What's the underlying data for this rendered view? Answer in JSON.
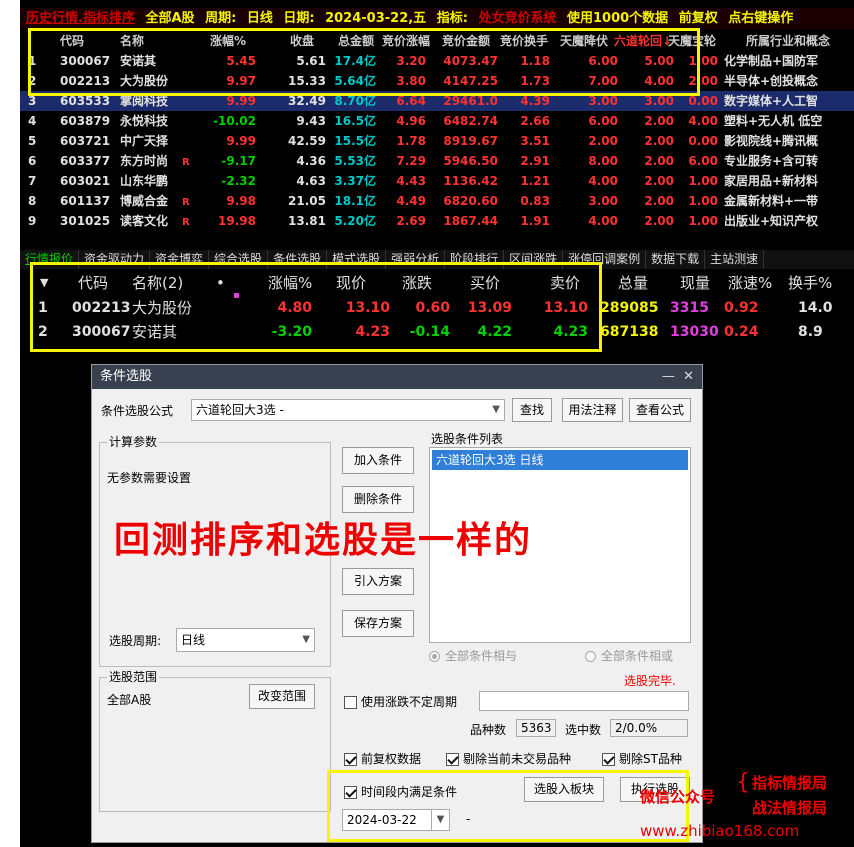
{
  "header": {
    "parts": [
      "历史行情.指标排序",
      "全部A股",
      "周期:",
      "日线",
      "日期:",
      "2024-03-22,五",
      "指标:",
      "处女竞价系统",
      "使用1000个数据",
      "前复权",
      "点右键操作"
    ]
  },
  "top_table": {
    "columns": [
      "代码",
      "名称",
      "涨幅%",
      "收盘",
      "总金额",
      "竞价涨幅",
      "竞价金额",
      "竞价换手",
      "天魔降伏",
      "六道轮回↓",
      "天魔宝轮",
      "所属行业和概念"
    ],
    "rows": [
      [
        "1",
        "300067",
        "安诺其",
        "5.45",
        "5.61",
        "17.4亿",
        "3.20",
        "4073.47",
        "1.18",
        "6.00",
        "5.00",
        "1.00",
        "化学制品+国防军"
      ],
      [
        "2",
        "002213",
        "大为股份",
        "9.97",
        "15.33",
        "5.64亿",
        "3.80",
        "4147.25",
        "1.73",
        "7.00",
        "4.00",
        "2.00",
        "半导体+创投概念"
      ],
      [
        "3",
        "603533",
        "掌阅科技",
        "9.99",
        "32.49",
        "8.70亿",
        "6.64",
        "29461.0",
        "4.39",
        "3.00",
        "3.00",
        "0.00",
        "数字媒体+人工智"
      ],
      [
        "4",
        "603879",
        "永悦科技",
        "-10.02",
        "9.43",
        "16.5亿",
        "4.96",
        "6482.74",
        "2.66",
        "6.00",
        "2.00",
        "4.00",
        "塑料+无人机 低空"
      ],
      [
        "5",
        "603721",
        "中广天择",
        "9.99",
        "42.59",
        "15.5亿",
        "1.78",
        "8919.67",
        "3.51",
        "2.00",
        "2.00",
        "0.00",
        "影视院线+腾讯概"
      ],
      [
        "6",
        "603377",
        "东方时尚",
        "-9.17",
        "4.36",
        "5.53亿",
        "7.29",
        "5946.50",
        "2.91",
        "8.00",
        "2.00",
        "6.00",
        "专业服务+含可转"
      ],
      [
        "7",
        "603021",
        "山东华鹏",
        "-2.32",
        "4.63",
        "3.37亿",
        "4.43",
        "1136.42",
        "1.21",
        "4.00",
        "2.00",
        "1.00",
        "家居用品+新材料"
      ],
      [
        "8",
        "601137",
        "博威合金",
        "9.98",
        "21.05",
        "18.1亿",
        "4.49",
        "6820.60",
        "0.83",
        "3.00",
        "2.00",
        "1.00",
        "金属新材料+一带"
      ],
      [
        "9",
        "301025",
        "读客文化",
        "19.98",
        "13.81",
        "5.20亿",
        "2.69",
        "1867.44",
        "1.91",
        "4.00",
        "2.00",
        "1.00",
        "出版业+知识产权"
      ]
    ],
    "r_flags": [
      "",
      "",
      "",
      "",
      "",
      "R",
      "",
      "R",
      "R"
    ]
  },
  "tabs": [
    "行情报价",
    "资金驱动力",
    "资金博弈",
    "综合选股",
    "条件选股",
    "模式选股",
    "强弱分析",
    "阶段排行",
    "区间涨跌",
    "涨停回调案例",
    "数据下载",
    "主站测速"
  ],
  "bottom_table": {
    "columns": [
      "代码",
      "名称(2)",
      "•",
      "涨幅%",
      "现价",
      "涨跌",
      "买价",
      "卖价",
      "总量",
      "现量",
      "涨速%",
      "换手%"
    ],
    "rows": [
      [
        "1",
        "002213",
        "大为股份",
        "4.80",
        "13.10",
        "0.60",
        "13.09",
        "13.10",
        "289085",
        "3315",
        "0.92",
        "14.0"
      ],
      [
        "2",
        "300067",
        "安诺其",
        "-3.20",
        "4.23",
        "-0.14",
        "4.22",
        "4.23",
        "687138",
        "13030",
        "0.24",
        "8.9"
      ]
    ]
  },
  "dialog": {
    "title": "条件选股",
    "formula_label": "条件选股公式",
    "formula_value": "六道轮回大3选  -",
    "btn_find": "查找",
    "btn_usage": "用法注释",
    "btn_view": "查看公式",
    "params_group": "计算参数",
    "params_text": "无参数需要设置",
    "btn_add": "加入条件",
    "btn_del": "删除条件",
    "btn_import": "引入方案",
    "btn_save": "保存方案",
    "list_label": "选股条件列表",
    "list_item": "六道轮回大3选  日线",
    "period_label": "选股周期:",
    "period_value": "日线",
    "radio_and": "全部条件相与",
    "radio_or": "全部条件相或",
    "status": "选股完毕.",
    "range_group": "选股范围",
    "range_value": "全部A股",
    "btn_range": "改变范围",
    "chk_uncertain": "使用涨跌不定周期",
    "count_label": "品种数",
    "count_value": "5363",
    "selected_label": "选中数",
    "selected_value": "2/0.0%",
    "chk_fq": "前复权数据",
    "chk_excl_untraded": "剔除当前未交易品种",
    "chk_excl_st": "剔除ST品种",
    "chk_timerange": "时间段内满足条件",
    "btn_to_block": "选股入板块",
    "btn_exec": "执行选股",
    "date_value": "2024-03-22",
    "date_sep": "-"
  },
  "overlay_text": "回测排序和选股是一样的",
  "watermark": {
    "wechat": "微信公众号",
    "line1": "指标情报局",
    "line2": "战法情报局",
    "url": "www.zhibiao168.com"
  },
  "colors": {
    "up": "#ff3232",
    "down": "#00d000",
    "neutral": "#e0e0e0",
    "yellow": "#f5f500",
    "cyan": "#00c8c8",
    "magenta": "#e040e0"
  }
}
